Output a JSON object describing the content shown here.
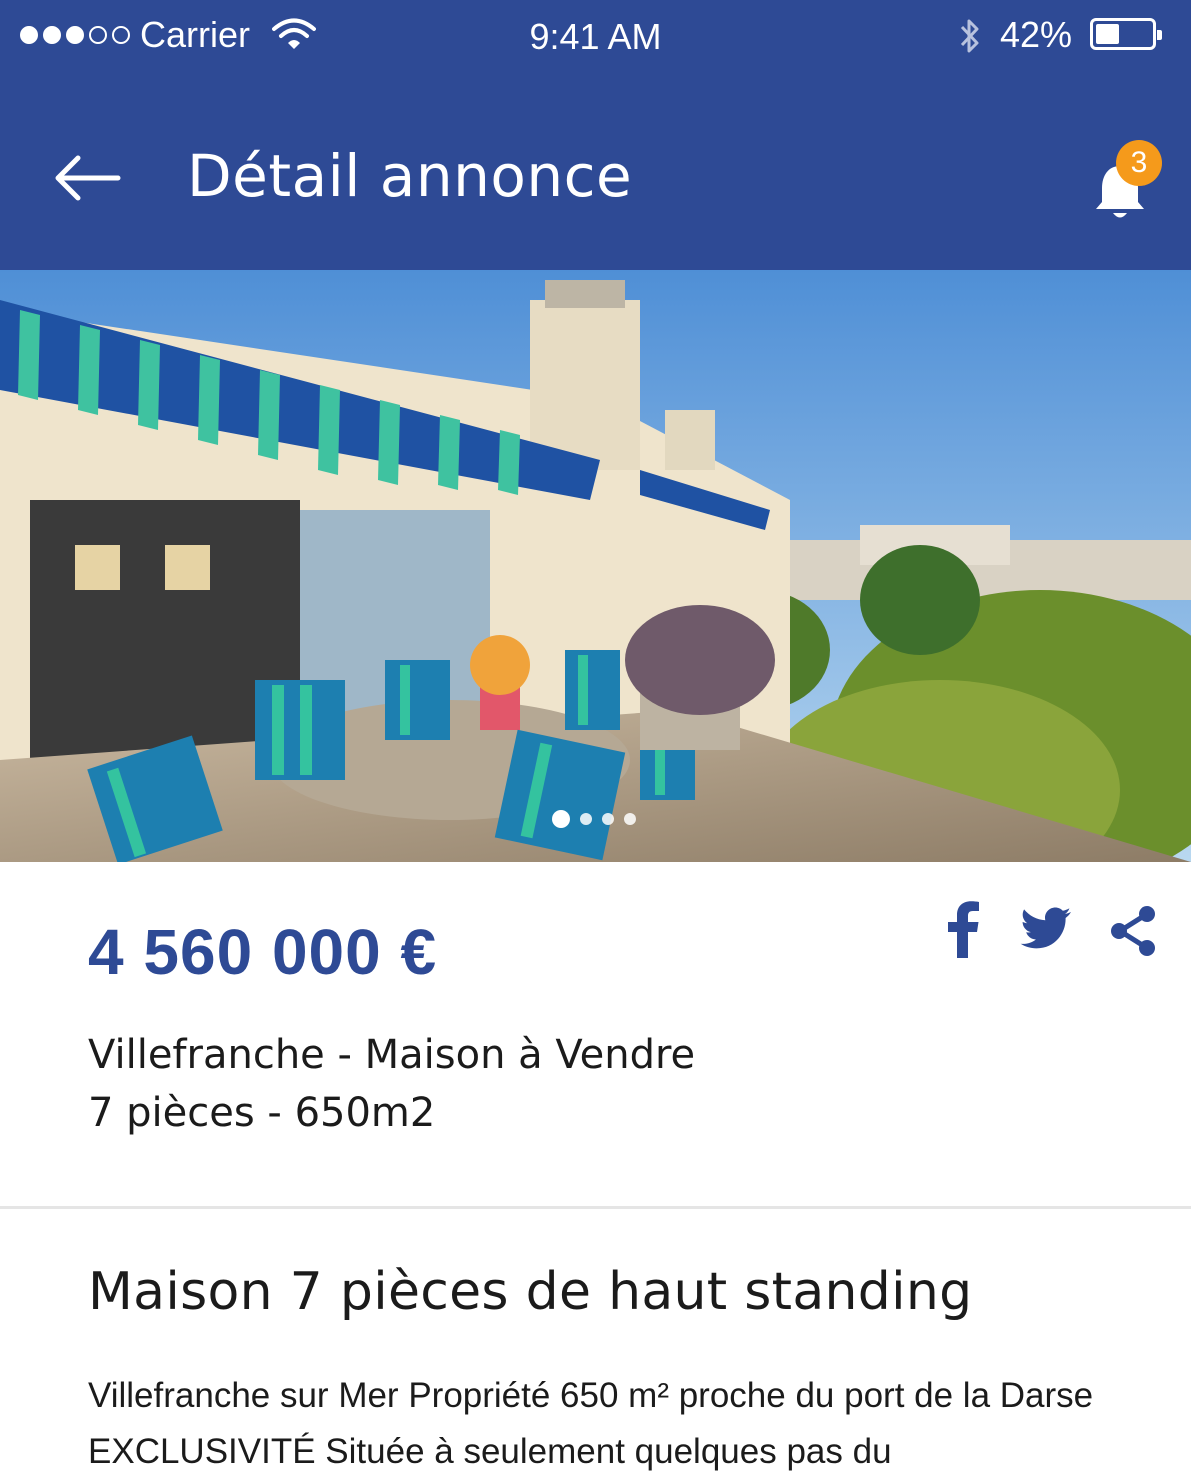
{
  "status_bar": {
    "carrier": "Carrier",
    "time": "9:41 AM",
    "battery": "42%",
    "battery_level": 0.42
  },
  "nav": {
    "title": "Détail annonce",
    "notification_count": "3"
  },
  "gallery": {
    "page_count": 4,
    "active_index": 0
  },
  "listing": {
    "price": "4 560 000 €",
    "location": "Villefranche - Maison à Vendre",
    "rooms_area": "7 pièces - 650m2",
    "title": "Maison 7 pièces de haut standing",
    "description": "Villefranche sur Mer Propriété 650 m² proche du port de la Darse EXCLUSIVITÉ Située à seulement quelques pas du"
  },
  "share": {
    "icons": [
      "facebook-icon",
      "twitter-icon",
      "share-icon"
    ]
  },
  "colors": {
    "primary": "#2e4a95",
    "badge": "#f59a1b"
  }
}
